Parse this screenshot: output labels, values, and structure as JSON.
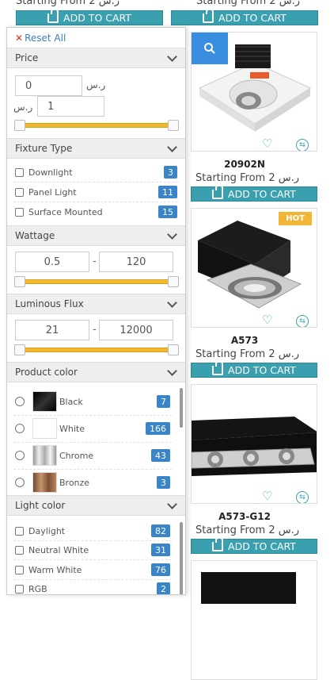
{
  "top_row": {
    "starting_left": "Starting From 2 ر.س",
    "starting_right": "Starting From 2 ر.س",
    "cart_left": "ADD TO CART",
    "cart_right": "ADD TO CART"
  },
  "products": [
    {
      "name": "20902N",
      "starting": "Starting From 2 ر.س",
      "cart": "ADD TO CART",
      "hot": ""
    },
    {
      "name": "A573",
      "starting": "Starting From 2 ر.س",
      "cart": "ADD TO CART",
      "hot": "HOT"
    },
    {
      "name": "A573-G12",
      "starting": "Starting From 2 ر.س",
      "cart": "ADD TO CART",
      "hot": ""
    }
  ],
  "filters": {
    "reset_label": "Reset All",
    "price": {
      "title": "Price",
      "min_value": "0",
      "max_value": "1",
      "currency": "ر.س",
      "range_fraction": [
        0.0,
        1.0
      ]
    },
    "fixture_type": {
      "title": "Fixture Type",
      "items": [
        {
          "label": "Downlight",
          "count": "3"
        },
        {
          "label": "Panel Light",
          "count": "11"
        },
        {
          "label": "Surface Mounted",
          "count": "15"
        }
      ]
    },
    "wattage": {
      "title": "Wattage",
      "min_value": "0.5",
      "max_value": "120",
      "separator": "-"
    },
    "luminous_flux": {
      "title": "Luminous Flux",
      "min_value": "21",
      "max_value": "12000",
      "separator": "-"
    },
    "product_color": {
      "title": "Product color",
      "items": [
        {
          "label": "Black",
          "count": "7",
          "color": "#111111"
        },
        {
          "label": "White",
          "count": "166",
          "color": "#ffffff"
        },
        {
          "label": "Chrome",
          "count": "43",
          "color": "#c9c9c9"
        },
        {
          "label": "Bronze",
          "count": "3",
          "color": "#9a6a48"
        }
      ]
    },
    "light_color": {
      "title": "Light color",
      "items": [
        {
          "label": "Daylight",
          "count": "82"
        },
        {
          "label": "Neutral White",
          "count": "31"
        },
        {
          "label": "Warm White",
          "count": "76"
        },
        {
          "label": "RGB",
          "count": "2"
        }
      ]
    }
  },
  "colors": {
    "accent": "#3aa0b0",
    "badge": "#3a85c7",
    "slider": "#f0b92f",
    "hot": "#f2b636",
    "reset_x": "#d9302c"
  }
}
